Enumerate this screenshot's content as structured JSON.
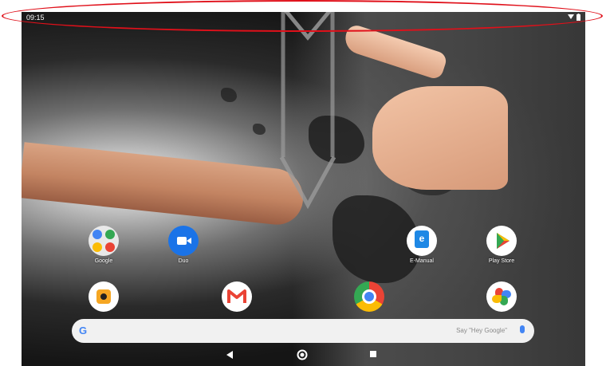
{
  "status_bar": {
    "time": "09:15"
  },
  "apps_row1": [
    {
      "label": "Google",
      "icon": "google-folder-icon"
    },
    {
      "label": "Duo",
      "icon": "duo-icon"
    },
    {
      "label": "E-Manual",
      "icon": "emanual-icon"
    },
    {
      "label": "Play Store",
      "icon": "play-store-icon"
    }
  ],
  "apps_row2": [
    {
      "label": "",
      "icon": "music-icon"
    },
    {
      "label": "",
      "icon": "gmail-icon"
    },
    {
      "label": "",
      "icon": "chrome-icon"
    },
    {
      "label": "",
      "icon": "photos-icon"
    }
  ],
  "search": {
    "logo": "G",
    "hint": "Say \"Hey Google\""
  },
  "colors": {
    "annotation": "#e0101a",
    "google_blue": "#4285f4",
    "duo_blue": "#1a73e8",
    "play_green": "#01875f"
  }
}
